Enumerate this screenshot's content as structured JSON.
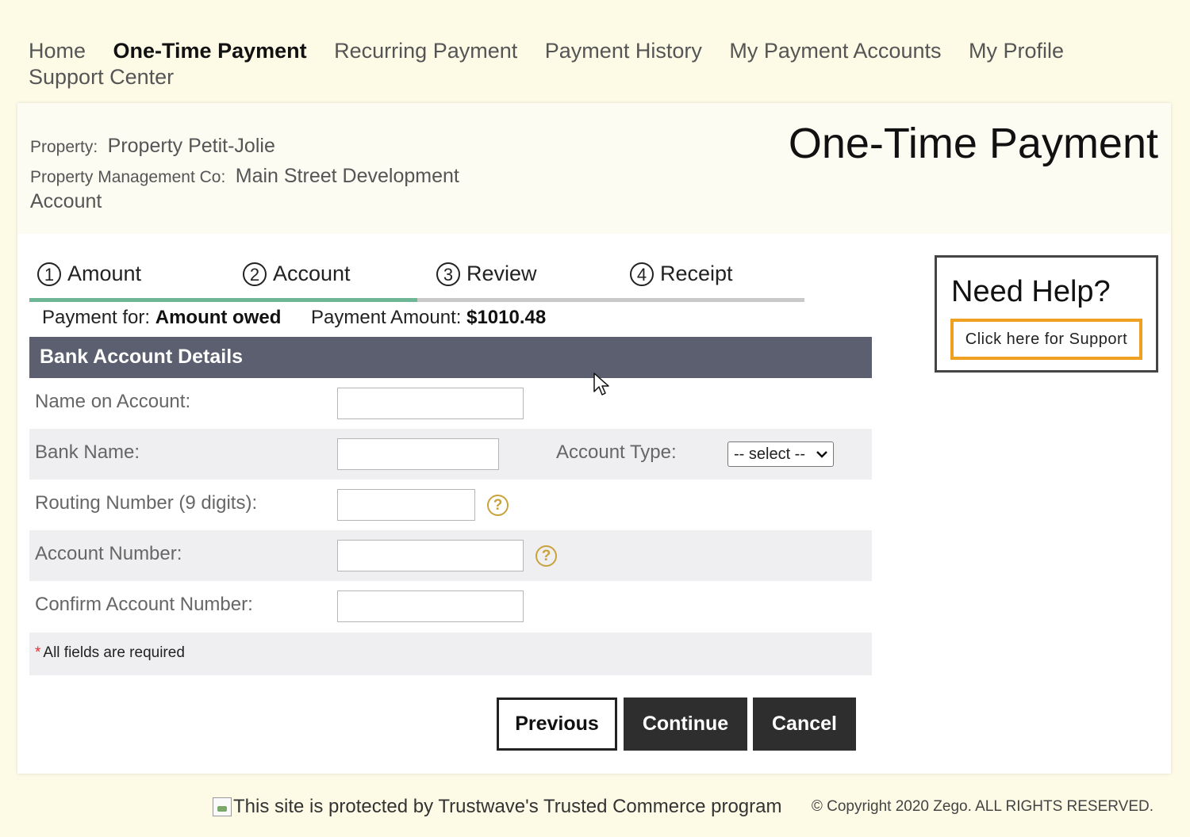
{
  "nav": {
    "items": [
      {
        "label": "Home",
        "active": false
      },
      {
        "label": "One-Time Payment",
        "active": true
      },
      {
        "label": "Recurring Payment",
        "active": false
      },
      {
        "label": "Payment History",
        "active": false
      },
      {
        "label": "My Payment Accounts",
        "active": false
      },
      {
        "label": "My Profile",
        "active": false
      },
      {
        "label": "Support Center",
        "active": false
      }
    ]
  },
  "header": {
    "property_label": "Property:",
    "property_value": "Property Petit-Jolie",
    "mgmt_label": "Property Management Co:",
    "mgmt_value": "Main Street Development Account",
    "page_title": "One-Time Payment"
  },
  "steps": {
    "items": [
      {
        "num": "1",
        "label": "Amount"
      },
      {
        "num": "2",
        "label": "Account"
      },
      {
        "num": "3",
        "label": "Review"
      },
      {
        "num": "4",
        "label": "Receipt"
      }
    ],
    "progress": 0.5
  },
  "payment": {
    "for_label": "Payment for:",
    "for_value": "Amount owed",
    "amount_label": "Payment Amount:",
    "amount_value": "$1010.48"
  },
  "form": {
    "section_title": "Bank Account Details",
    "name_label": "Name on Account:",
    "bank_label": "Bank Name:",
    "account_type_label": "Account Type:",
    "account_type_selected": "-- select --",
    "routing_label": "Routing Number (9 digits):",
    "account_label": "Account Number:",
    "confirm_label": "Confirm Account Number:",
    "required_star": "*",
    "required_note": "All fields are required",
    "help_glyph": "?"
  },
  "buttons": {
    "previous": "Previous",
    "continue": "Continue",
    "cancel": "Cancel"
  },
  "help": {
    "title": "Need Help?",
    "support_label": "Click here for Support"
  },
  "footer": {
    "trust_text": "This site is protected by Trustwave's Trusted Commerce program",
    "copyright": "© Copyright 2020 Zego. ALL RIGHTS RESERVED."
  },
  "colors": {
    "page_bg": "#fdfbe6",
    "section_header": "#5b5f6f",
    "progress_fill": "#6fb696",
    "help_accent": "#c9a23b",
    "support_border": "#f0a020"
  }
}
